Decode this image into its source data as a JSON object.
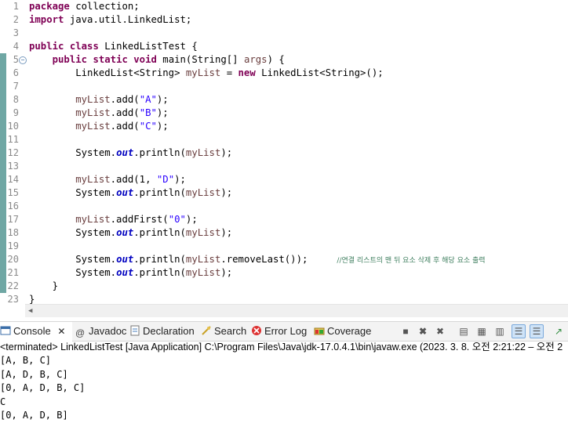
{
  "editor": {
    "lines": [
      {
        "n": "1",
        "html": "<span class=\"kw\">package</span> collection;"
      },
      {
        "n": "2",
        "html": "<span class=\"kw\">import</span> java.util.LinkedList;"
      },
      {
        "n": "3",
        "html": ""
      },
      {
        "n": "4",
        "html": "<span class=\"kw\">public</span> <span class=\"kw\">class</span> LinkedListTest {"
      },
      {
        "n": "5",
        "html": "    <span class=\"kw\">public</span> <span class=\"kw\">static</span> <span class=\"kw\">void</span> main(String[] <span class=\"var\">args</span>) {"
      },
      {
        "n": "6",
        "html": "        LinkedList&lt;String&gt; <span class=\"var\">myList</span> = <span class=\"kw\">new</span> LinkedList&lt;String&gt;();"
      },
      {
        "n": "7",
        "html": ""
      },
      {
        "n": "8",
        "html": "        <span class=\"var\">myList</span>.add(<span class=\"str\">\"A\"</span>);"
      },
      {
        "n": "9",
        "html": "        <span class=\"var\">myList</span>.add(<span class=\"str\">\"B\"</span>);"
      },
      {
        "n": "10",
        "html": "        <span class=\"var\">myList</span>.add(<span class=\"str\">\"C\"</span>);"
      },
      {
        "n": "11",
        "html": ""
      },
      {
        "n": "12",
        "html": "        System.<span class=\"fld\">out</span>.println(<span class=\"var\">myList</span>);"
      },
      {
        "n": "13",
        "html": ""
      },
      {
        "n": "14",
        "html": "        <span class=\"var\">myList</span>.add(1, <span class=\"str\">\"D\"</span>);"
      },
      {
        "n": "15",
        "html": "        System.<span class=\"fld\">out</span>.println(<span class=\"var\">myList</span>);"
      },
      {
        "n": "16",
        "html": ""
      },
      {
        "n": "17",
        "html": "        <span class=\"var\">myList</span>.addFirst(<span class=\"str\">\"0\"</span>);"
      },
      {
        "n": "18",
        "html": "        System.<span class=\"fld\">out</span>.println(<span class=\"var\">myList</span>);"
      },
      {
        "n": "19",
        "html": ""
      },
      {
        "n": "20",
        "html": "        System.<span class=\"fld\">out</span>.println(<span class=\"var\">myList</span>.removeLast());     <span class=\"cmt\">//연결 리스트의 맨 뒤 요소 삭제 후 해당 요소 출력</span>"
      },
      {
        "n": "21",
        "html": "        System.<span class=\"fld\">out</span>.println(<span class=\"var\">myList</span>);"
      },
      {
        "n": "22",
        "html": "    }"
      },
      {
        "n": "23",
        "html": "}"
      }
    ]
  },
  "tabs": {
    "console": "Console",
    "javadoc": "Javadoc",
    "declaration": "Declaration",
    "search": "Search",
    "errorlog": "Error Log",
    "coverage": "Coverage"
  },
  "status": "<terminated> LinkedListTest [Java Application] C:\\Program Files\\Java\\jdk-17.0.4.1\\bin\\javaw.exe  (2023. 3. 8. 오전 2:21:22 – 오전 2",
  "output": [
    "[A, B, C]",
    "[A, D, B, C]",
    "[0, A, D, B, C]",
    "C",
    "[0, A, D, B]"
  ],
  "colors": {
    "keyword": "#7f0055",
    "string": "#2a00ff",
    "field": "#0000c0",
    "comment": "#3f7f5f",
    "marker": "#6fa7a4"
  }
}
